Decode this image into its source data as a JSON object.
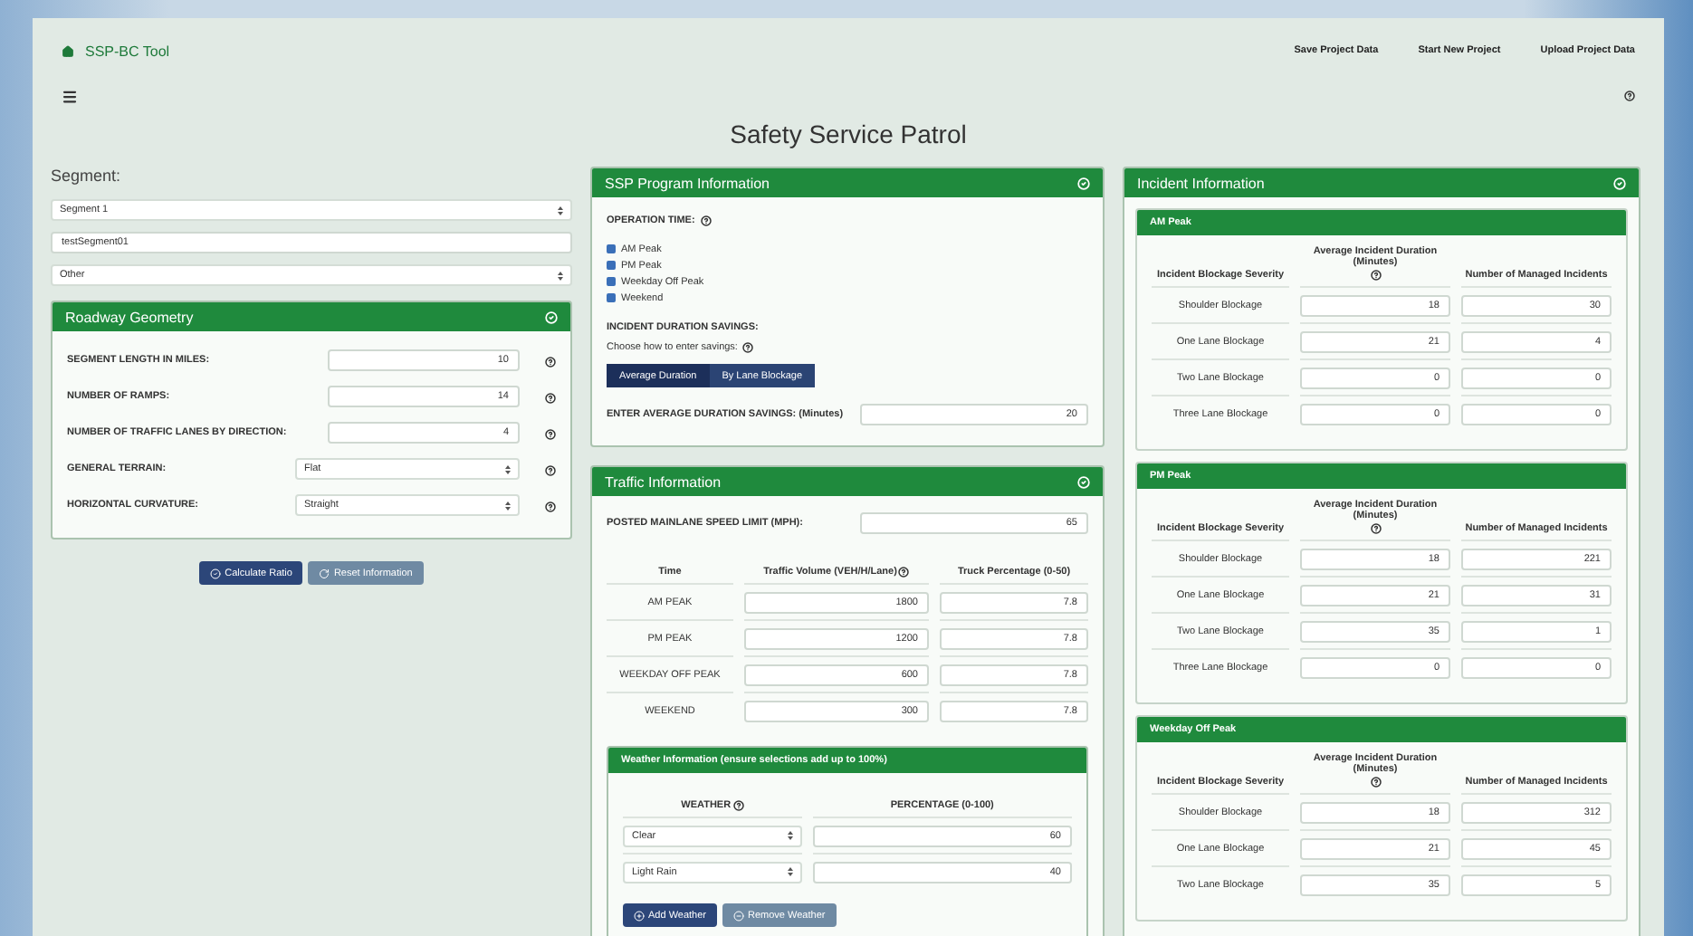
{
  "nav": {
    "brand": "SSP-BC Tool",
    "links": [
      "Save Project Data",
      "Start New Project",
      "Upload Project Data"
    ]
  },
  "page_title": "Safety Service Patrol",
  "segment": {
    "label": "Segment:",
    "select": "Segment 1",
    "name": "testSegment01",
    "type": "Other"
  },
  "geometry": {
    "title": "Roadway Geometry",
    "fields": [
      {
        "label": "SEGMENT LENGTH IN MILES:",
        "kind": "input",
        "value": "10"
      },
      {
        "label": "NUMBER OF RAMPS:",
        "kind": "input",
        "value": "14"
      },
      {
        "label": "NUMBER OF TRAFFIC LANES BY DIRECTION:",
        "kind": "input",
        "value": "4"
      },
      {
        "label": "GENERAL TERRAIN:",
        "kind": "select",
        "value": "Flat"
      },
      {
        "label": "HORIZONTAL CURVATURE:",
        "kind": "select",
        "value": "Straight"
      }
    ]
  },
  "actions": [
    "Calculate Ratio",
    "Reset Information"
  ],
  "program": {
    "title": "SSP Program Information",
    "operation_label": "OPERATION TIME:",
    "times": [
      {
        "label": "AM Peak",
        "checked": true
      },
      {
        "label": "PM Peak",
        "checked": true
      },
      {
        "label": "Weekday Off Peak",
        "checked": true
      },
      {
        "label": "Weekend",
        "checked": true
      }
    ],
    "savings_label": "INCIDENT DURATION SAVINGS:",
    "choose_label": "Choose how to enter savings:",
    "modes": [
      {
        "label": "Average Duration",
        "selected": true
      },
      {
        "label": "By Lane Blockage",
        "selected": false
      }
    ],
    "avg_label": "ENTER AVERAGE DURATION SAVINGS: (Minutes)",
    "avg_value": "20"
  },
  "traffic": {
    "title": "Traffic Information",
    "speed_label": "POSTED MAINLANE SPEED LIMIT (MPH):",
    "speed": "65",
    "columns": [
      "Time",
      "Traffic Volume (VEH/H/Lane)",
      "Truck Percentage (0-50)"
    ],
    "rows": [
      {
        "time": "AM PEAK",
        "volume": "1800",
        "truck": "7.8"
      },
      {
        "time": "PM PEAK",
        "volume": "1200",
        "truck": "7.8"
      },
      {
        "time": "WEEKDAY OFF PEAK",
        "volume": "600",
        "truck": "7.8"
      },
      {
        "time": "WEEKEND",
        "volume": "300",
        "truck": "7.8"
      }
    ]
  },
  "weather": {
    "title": "Weather Information (ensure selections add up to 100%)",
    "columns": [
      "WEATHER",
      "PERCENTAGE (0-100)"
    ],
    "rows": [
      {
        "weather": "Clear",
        "percentage": "60"
      },
      {
        "weather": "Light Rain",
        "percentage": "40"
      }
    ],
    "buttons": [
      "Add Weather",
      "Remove Weather"
    ]
  },
  "incident": {
    "title": "Incident Information",
    "periods": [
      {
        "title": "AM Peak",
        "columns": [
          "Incident Blockage Severity",
          "Average Incident Duration (Minutes)",
          "Number of Managed Incidents"
        ],
        "rows": [
          {
            "severity": "Shoulder Blockage",
            "duration": "18",
            "count": "30"
          },
          {
            "severity": "One Lane Blockage",
            "duration": "21",
            "count": "4"
          },
          {
            "severity": "Two Lane Blockage",
            "duration": "0",
            "count": "0"
          },
          {
            "severity": "Three Lane Blockage",
            "duration": "0",
            "count": "0"
          }
        ]
      },
      {
        "title": "PM Peak",
        "columns": [
          "Incident Blockage Severity",
          "Average Incident Duration (Minutes)",
          "Number of Managed Incidents"
        ],
        "rows": [
          {
            "severity": "Shoulder Blockage",
            "duration": "18",
            "count": "221"
          },
          {
            "severity": "One Lane Blockage",
            "duration": "21",
            "count": "31"
          },
          {
            "severity": "Two Lane Blockage",
            "duration": "35",
            "count": "1"
          },
          {
            "severity": "Three Lane Blockage",
            "duration": "0",
            "count": "0"
          }
        ]
      },
      {
        "title": "Weekday Off Peak",
        "columns": [
          "Incident Blockage Severity",
          "Average Incident Duration (Minutes)",
          "Number of Managed Incidents"
        ],
        "rows": [
          {
            "severity": "Shoulder Blockage",
            "duration": "18",
            "count": "312"
          },
          {
            "severity": "One Lane Blockage",
            "duration": "21",
            "count": "45"
          },
          {
            "severity": "Two Lane Blockage",
            "duration": "35",
            "count": "5"
          }
        ]
      }
    ]
  }
}
